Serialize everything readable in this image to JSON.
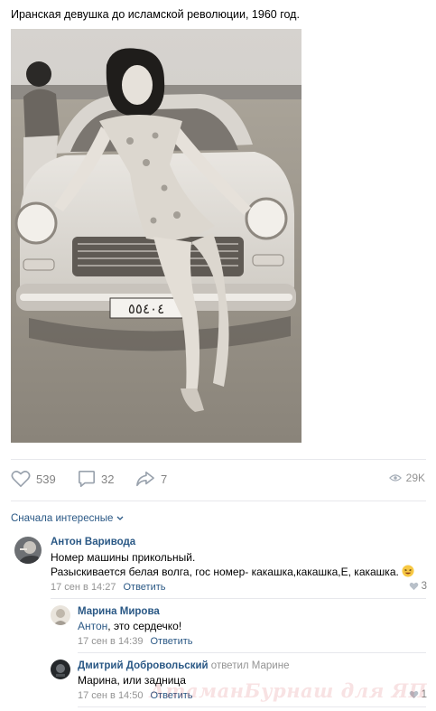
{
  "post": {
    "text": "Иранская девушка до исламской революции, 1960 год.",
    "plate": "٥٥٤٠٤"
  },
  "actions": {
    "likes": "539",
    "comments": "32",
    "shares": "7",
    "views": "29K"
  },
  "comments_header": {
    "sort_label": "Сначала интересные"
  },
  "comments": [
    {
      "author": "Антон Варивода",
      "lines": [
        "Номер машины прикольный.",
        "Разыскивается белая волга, гос номер- какашка,какашка,Е, какашка."
      ],
      "date": "17 сен в 14:27",
      "reply_label": "Ответить",
      "likes": "3"
    },
    {
      "author": "Марина Мирова",
      "mention": "Антон",
      "text": ", это сердечко!",
      "date": "17 сен в 14:39",
      "reply_label": "Ответить"
    },
    {
      "author": "Дмитрий Добровольский",
      "reply_to": "ответил Марине",
      "text": "Марина, или задница",
      "date": "17 сен в 14:50",
      "reply_label": "Ответить",
      "likes": "1"
    }
  ],
  "watermark": "АтаманБурнаш для ЯП",
  "colors": {
    "link": "#2a5885",
    "muted": "#939393",
    "separator": "#e7e8ec"
  }
}
